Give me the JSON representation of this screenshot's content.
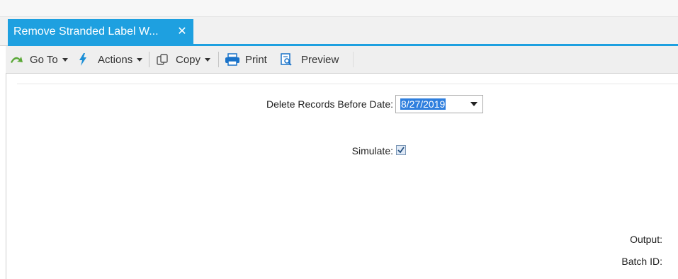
{
  "tab": {
    "title": "Remove Stranded Label W...",
    "close_glyph": "✕"
  },
  "toolbar": {
    "goto_label": "Go To",
    "actions_label": "Actions",
    "copy_label": "Copy",
    "print_label": "Print",
    "preview_label": "Preview"
  },
  "form": {
    "delete_label": "Delete Records Before Date:",
    "delete_value": "8/27/2019",
    "simulate_label": "Simulate:",
    "simulate_checked": true,
    "output_label": "Output:",
    "batch_label": "Batch ID:"
  },
  "icons": {
    "goto": "green-arrow-icon",
    "actions": "lightning-icon",
    "copy": "copy-icon",
    "print": "printer-icon",
    "preview": "preview-icon"
  },
  "colors": {
    "tab_accent": "#1ea0e0",
    "selection": "#2f7fde",
    "goto_icon": "#5aa837",
    "actions_icon": "#1c8fd6",
    "print_icon": "#1a73c9"
  }
}
